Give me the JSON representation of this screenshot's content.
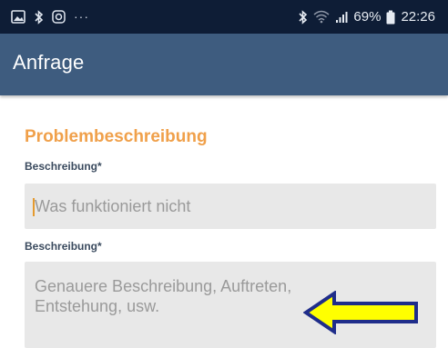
{
  "status_bar": {
    "left_icons": [
      "gallery-icon",
      "bluetooth-small-icon",
      "instagram-icon"
    ],
    "overflow": "···",
    "right_icons": [
      "bluetooth-icon",
      "wifi-icon",
      "signal-icon",
      "battery-icon"
    ],
    "battery": "69%",
    "time": "22:26"
  },
  "app_bar": {
    "title": "Anfrage"
  },
  "form": {
    "section_title": "Problembeschreibung",
    "field1": {
      "label": "Beschreibung*",
      "placeholder": "Was funktioniert nicht"
    },
    "field2": {
      "label": "Beschreibung*",
      "placeholder_line1": "Genauere Beschreibung, Auftreten,",
      "placeholder_line2": "Entstehung, usw."
    }
  },
  "annotation": {
    "arrow_color": "#ffff00",
    "arrow_outline": "#1f2d8a"
  },
  "colors": {
    "status_bar": "#0e1d36",
    "app_bar": "#3e5c7f",
    "accent": "#f0a04a",
    "input_bg": "#e8e8e8"
  }
}
